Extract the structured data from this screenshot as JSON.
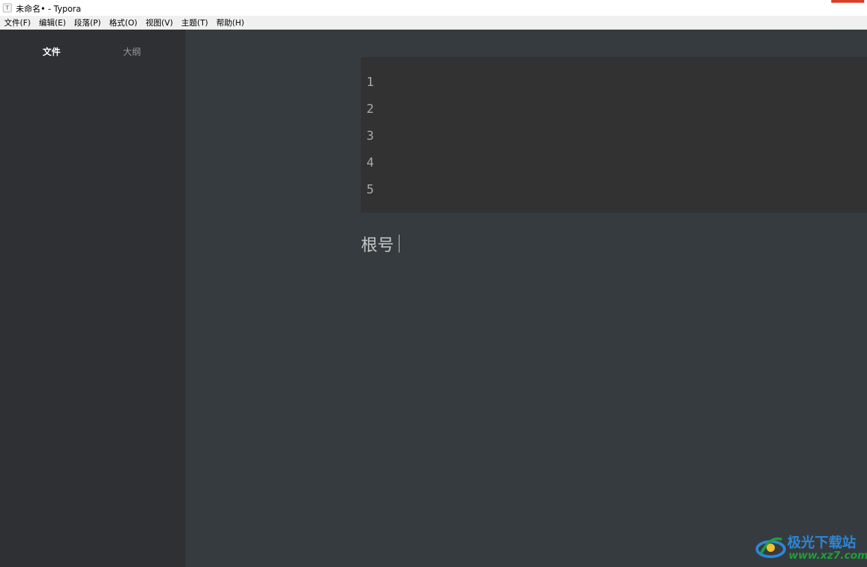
{
  "window": {
    "app_icon": "T",
    "title": "未命名• - Typora"
  },
  "menu": [
    "文件(F)",
    "编辑(E)",
    "段落(P)",
    "格式(O)",
    "视图(V)",
    "主题(T)",
    "帮助(H)"
  ],
  "sidebar": {
    "tabs": [
      {
        "label": "文件",
        "active": true
      },
      {
        "label": "大纲",
        "active": false
      }
    ]
  },
  "editor": {
    "code_block_lines": [
      "1",
      "2",
      "3",
      "4",
      "5"
    ],
    "paragraph_text": "根号"
  },
  "watermark": {
    "title": "极光下载站",
    "url": "www.xz7.com"
  },
  "colors": {
    "sidebar_bg": "#2e3033",
    "editor_bg": "#363b40",
    "code_bg": "#333232",
    "close_button": "#d9402c",
    "watermark_blue": "#2c87d8",
    "watermark_green": "#1e9f3a"
  }
}
